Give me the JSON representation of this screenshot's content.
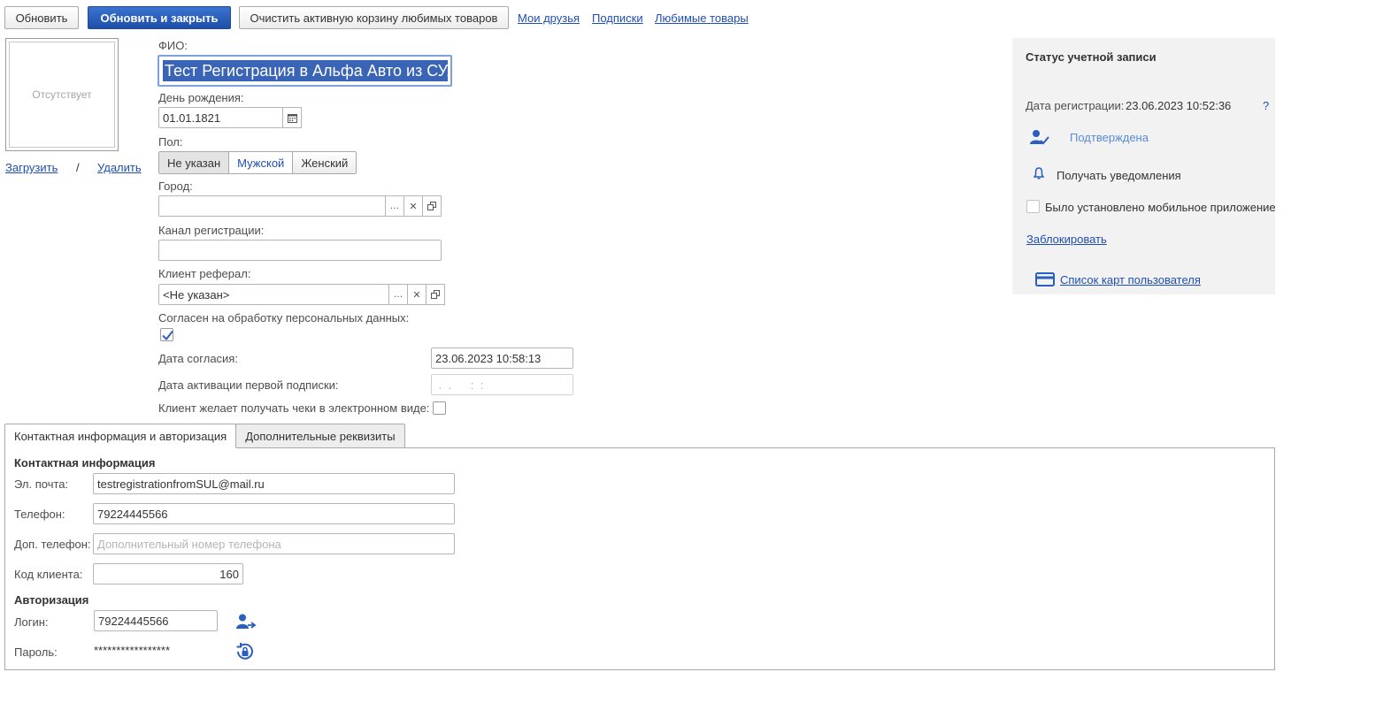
{
  "toolbar": {
    "refresh_label": "Обновить",
    "refresh_close_label": "Обновить и закрыть",
    "clear_cart_label": "Очистить активную корзину любимых товаров",
    "links": [
      "Мои друзья",
      "Подписки",
      "Любимые товары"
    ]
  },
  "photo": {
    "placeholder": "Отсутствует",
    "upload_label": "Загрузить",
    "separator": "/",
    "delete_label": "Удалить"
  },
  "form": {
    "fio_label": "ФИО:",
    "fio_value": "Тест Регистрация в Альфа Авто из СУЛ",
    "birthday_label": "День рождения:",
    "birthday_value": "01.01.1821",
    "gender_label": "Пол:",
    "gender_options": [
      "Не указан",
      "Мужской",
      "Женский"
    ],
    "gender_selected": "Не указан",
    "city_label": "Город:",
    "city_value": "",
    "channel_label": "Канал регистрации:",
    "channel_value": "",
    "referral_label": "Клиент реферал:",
    "referral_value": "<Не указан>",
    "consent_label": "Согласен на обработку персональных данных:",
    "consent_checked": true,
    "consent_date_label": "Дата согласия:",
    "consent_date_value": "23.06.2023 10:58:13",
    "first_sub_label": "Дата активации первой подписки:",
    "first_sub_value": " .  .      :  :",
    "e_receipt_label": "Клиент желает получать чеки в электронном виде:",
    "e_receipt_checked": false
  },
  "status_panel": {
    "title": "Статус учетной записи",
    "reg_date_label": "Дата регистрации:",
    "reg_date_value": "23.06.2023 10:52:36",
    "help": "?",
    "confirmed_label": "Подтверждена",
    "notifications_label": "Получать уведомления",
    "mobile_app_label": "Было установлено мобильное приложение",
    "mobile_app_checked": false,
    "block_label": "Заблокировать",
    "cards_label": "Список карт пользователя"
  },
  "tabs": [
    {
      "label": "Контактная информация и авторизация",
      "active": true
    },
    {
      "label": "Дополнительные реквизиты",
      "active": false
    }
  ],
  "contact": {
    "section_title": "Контактная информация",
    "email_label": "Эл. почта:",
    "email_value": "testregistrationfromSUL@mail.ru",
    "phone_label": "Телефон:",
    "phone_value": "79224445566",
    "extra_phone_label": "Доп. телефон:",
    "extra_phone_placeholder": "Дополнительный номер телефона",
    "client_code_label": "Код клиента:",
    "client_code_value": "160"
  },
  "auth": {
    "section_title": "Авторизация",
    "login_label": "Логин:",
    "login_value": "79224445566",
    "password_label": "Пароль:",
    "password_value": "*****************"
  },
  "colors": {
    "accent": "#1f4eb4",
    "primary_button": "#2a5fbd",
    "selection": "#3a64b5",
    "panel_bg": "#f2f2f2"
  }
}
